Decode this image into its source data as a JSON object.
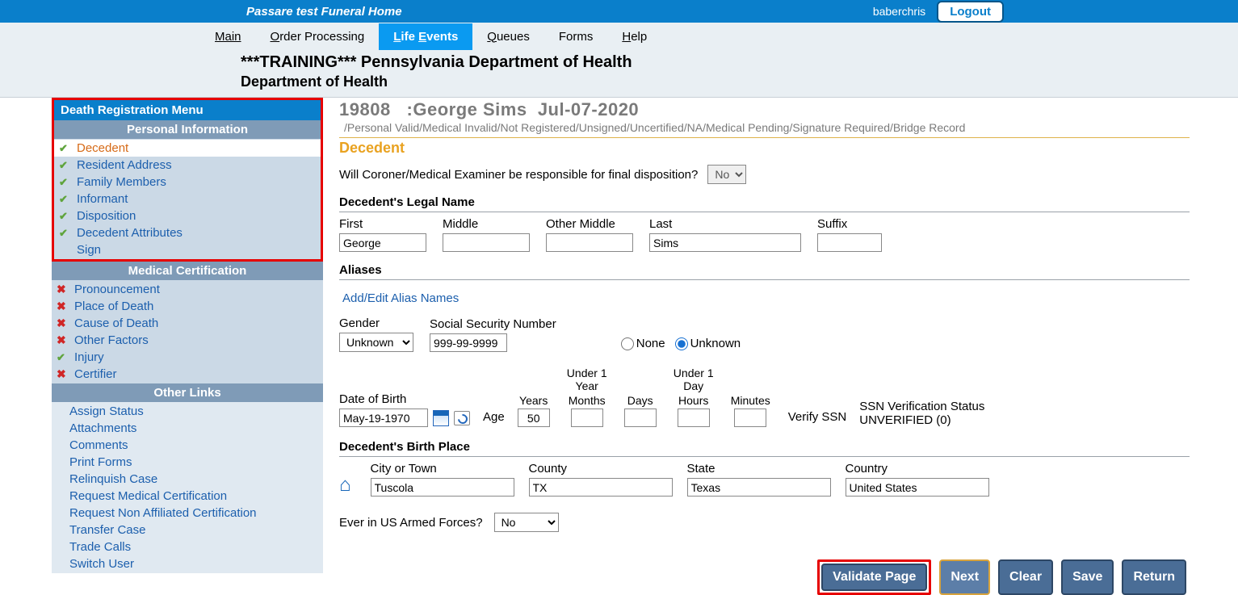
{
  "topbar": {
    "home_name": "Passare test Funeral Home",
    "username": "baberchris",
    "logout": "Logout"
  },
  "nav": {
    "main": "Main",
    "order": "Order Processing",
    "life": "Life Events",
    "queues": "Queues",
    "forms": "Forms",
    "help": "Help"
  },
  "dept": {
    "line1": "***TRAINING*** Pennsylvania Department of Health",
    "line2": "Department of Health"
  },
  "sidebar": {
    "menu_title": "Death Registration Menu",
    "personal": {
      "header": "Personal Information",
      "items": [
        "Decedent",
        "Resident Address",
        "Family Members",
        "Informant",
        "Disposition",
        "Decedent Attributes",
        "Sign"
      ]
    },
    "medical": {
      "header": "Medical Certification",
      "items": [
        "Pronouncement",
        "Place of Death",
        "Cause of Death",
        "Other Factors",
        "Injury",
        "Certifier"
      ],
      "status": [
        "x",
        "x",
        "x",
        "x",
        "check",
        "x"
      ]
    },
    "other": {
      "header": "Other Links",
      "items": [
        "Assign Status",
        "Attachments",
        "Comments",
        "Print Forms",
        "Relinquish Case",
        "Request Medical Certification",
        "Request Non Affiliated Certification",
        "Transfer Case",
        "Trade Calls",
        "Switch User"
      ]
    }
  },
  "caseheader": {
    "id": "19808",
    "name": ":George Sims",
    "date": "Jul-07-2020",
    "status": "/Personal Valid/Medical Invalid/Not Registered/Unsigned/Uncertified/NA/Medical Pending/Signature Required/Bridge Record"
  },
  "page": {
    "title": "Decedent",
    "coroner_q": "Will Coroner/Medical Examiner be responsible for final disposition?",
    "coroner_val": "No",
    "legal_name_header": "Decedent's Legal Name",
    "labels": {
      "first": "First",
      "middle": "Middle",
      "omiddle": "Other Middle",
      "last": "Last",
      "suffix": "Suffix"
    },
    "values": {
      "first": "George",
      "middle": "",
      "omiddle": "",
      "last": "Sims",
      "suffix": ""
    },
    "aliases_header": "Aliases",
    "alias_link": "Add/Edit Alias Names",
    "gender_label": "Gender",
    "gender_value": "Unknown",
    "ssn_label": "Social Security Number",
    "ssn_value": "999-99-9999",
    "ssn_none": "None",
    "ssn_unknown": "Unknown",
    "dob_label": "Date of Birth",
    "dob_value": "May-19-1970",
    "age_label": "Age",
    "years_label": "Years",
    "years_value": "50",
    "u1y_top": "Under 1 Year",
    "u1d_top": "Under 1 Day",
    "months_label": "Months",
    "days_label": "Days",
    "hours_label": "Hours",
    "minutes_label": "Minutes",
    "verify_ssn": "Verify SSN",
    "ssn_status_label": "SSN Verification Status",
    "ssn_status_value": "UNVERIFIED (0)",
    "birthplace_header": "Decedent's Birth Place",
    "bp_labels": {
      "city": "City or Town",
      "county": "County",
      "state": "State",
      "country": "Country"
    },
    "bp_values": {
      "city": "Tuscola",
      "county": "TX",
      "state": "Texas",
      "country": "United States"
    },
    "armed_q": "Ever in US Armed Forces?",
    "armed_val": "No"
  },
  "buttons": {
    "validate": "Validate Page",
    "next": "Next",
    "clear": "Clear",
    "save": "Save",
    "return": "Return"
  }
}
